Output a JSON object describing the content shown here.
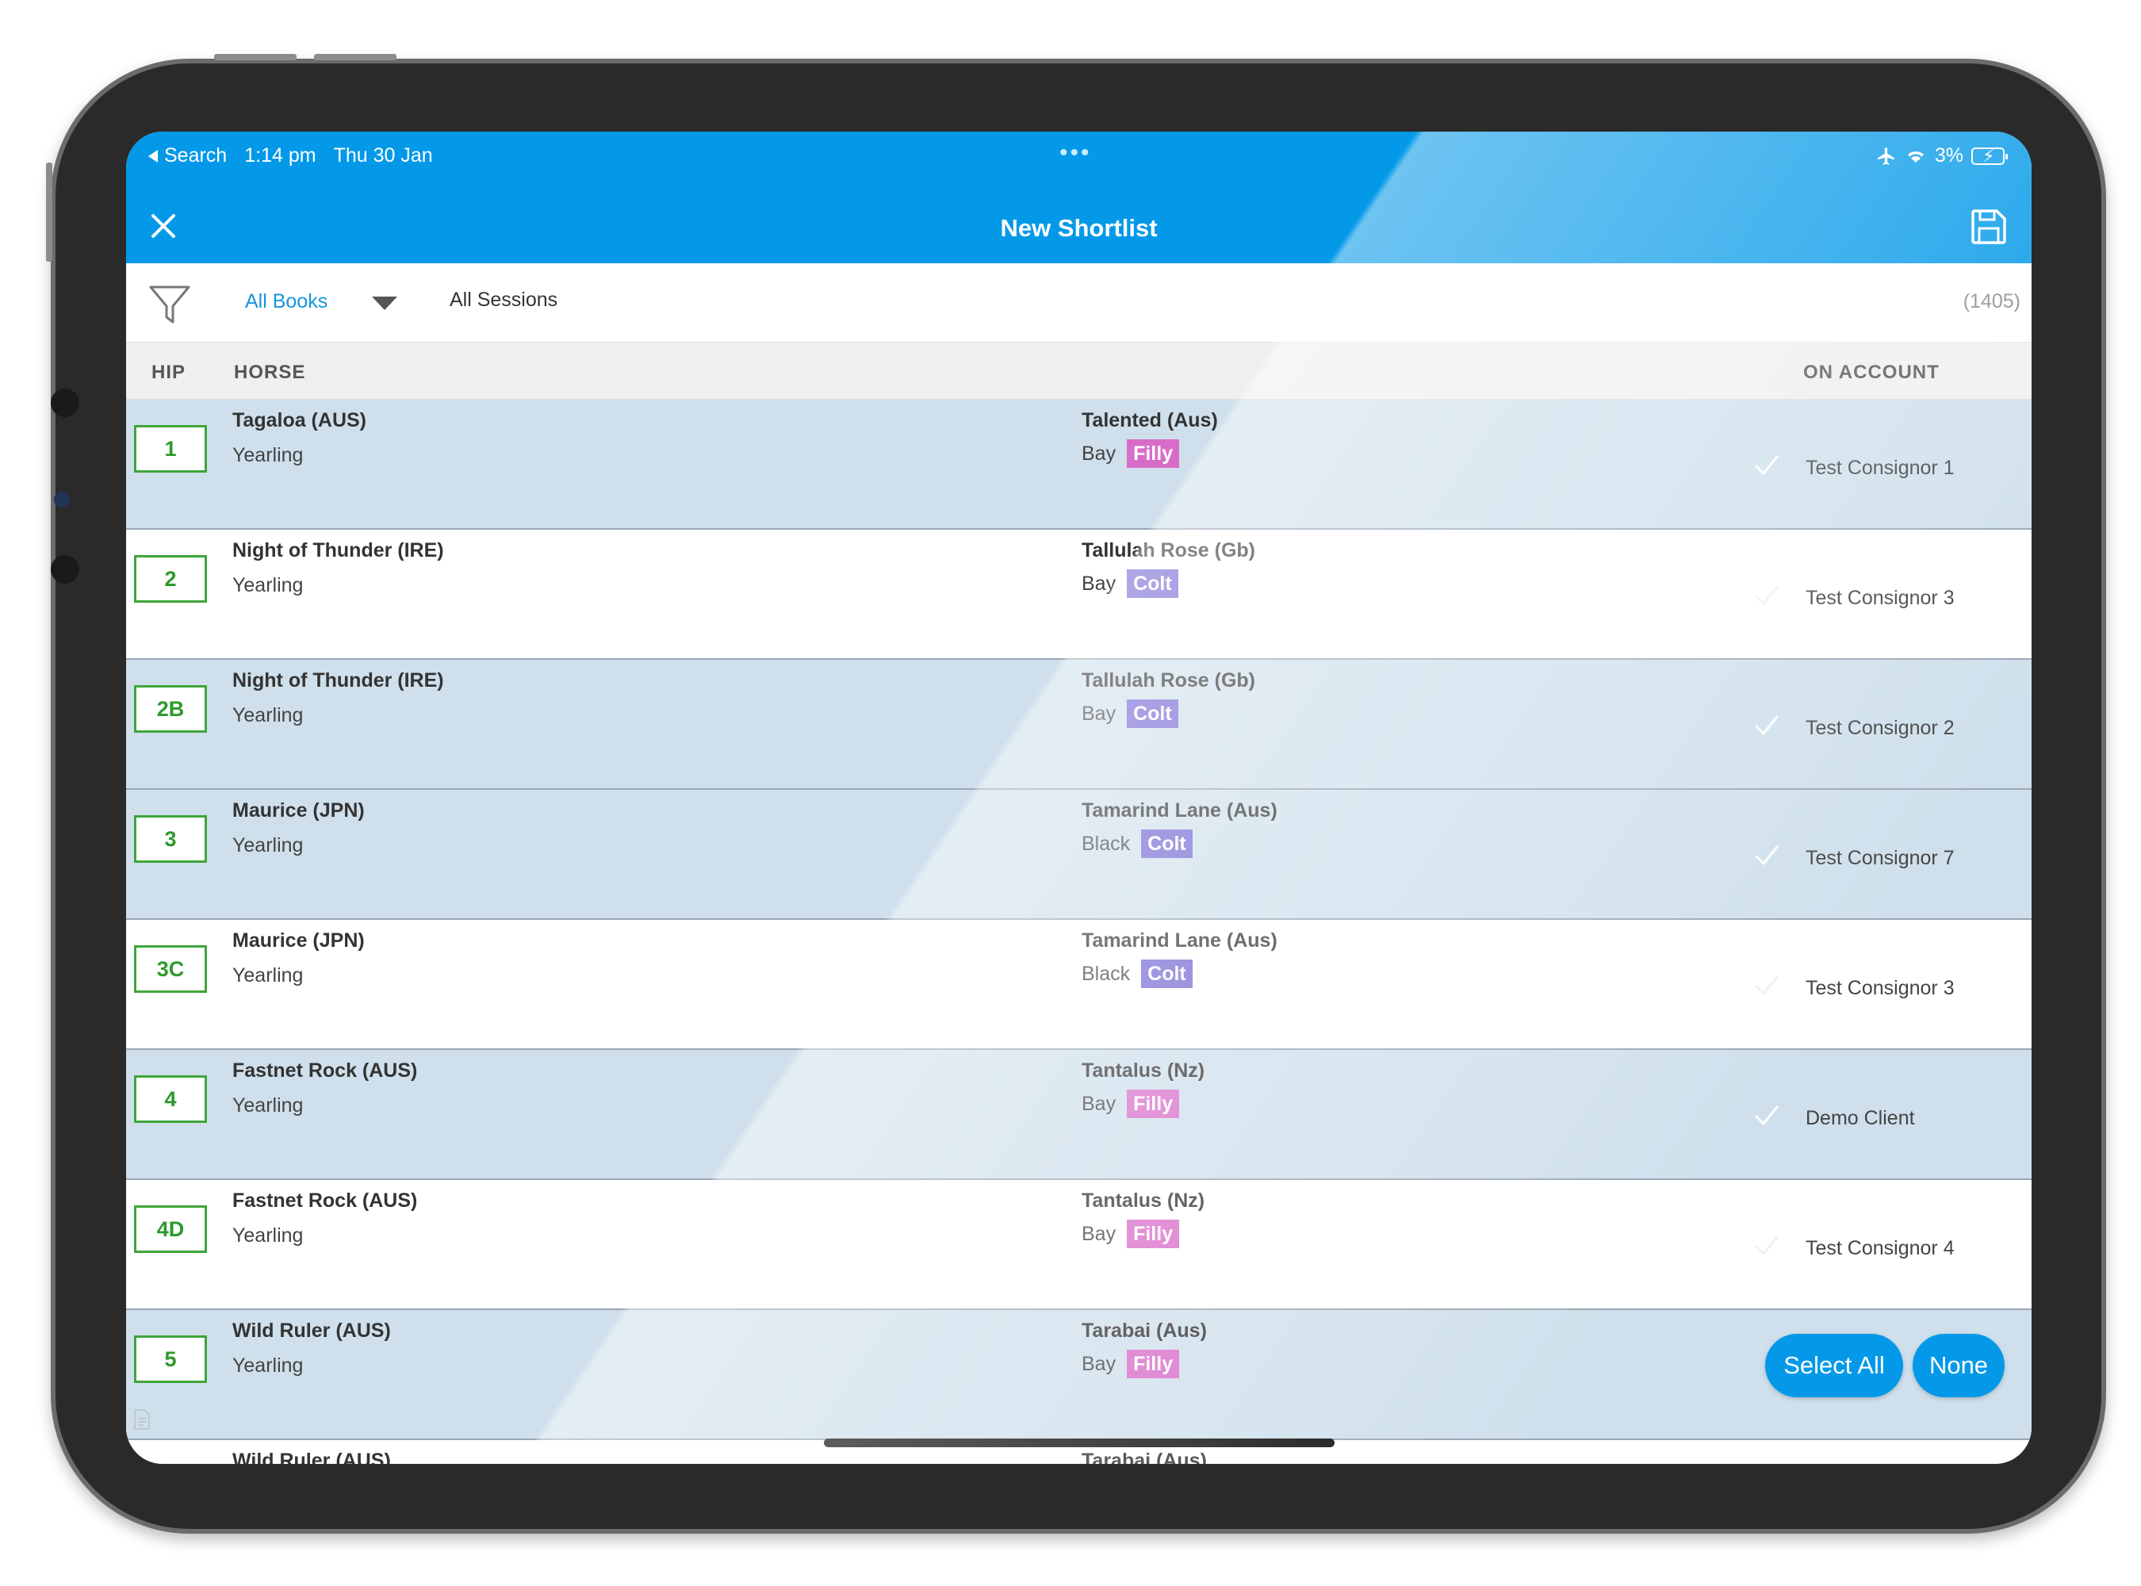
{
  "status_bar": {
    "back_label": "Search",
    "time": "1:14 pm",
    "date": "Thu 30 Jan",
    "dots": "•••",
    "battery": "3%"
  },
  "header": {
    "title": "New Shortlist"
  },
  "filter": {
    "books": "All Books",
    "sessions": "All Sessions",
    "count": "(1405)"
  },
  "columns": {
    "hip": "HIP",
    "horse": "HORSE",
    "account": "ON ACCOUNT"
  },
  "rows": [
    {
      "hip": "1",
      "sire": "Tagaloa (AUS)",
      "age": "Yearling",
      "dam": "Talented (Aus)",
      "color": "Bay",
      "sex": "Filly",
      "account": "Test Consignor 1",
      "selected": true
    },
    {
      "hip": "2",
      "sire": "Night of Thunder (IRE)",
      "age": "Yearling",
      "dam": "Tallulah Rose (Gb)",
      "color": "Bay",
      "sex": "Colt",
      "account": "Test Consignor 3",
      "selected": false
    },
    {
      "hip": "2B",
      "sire": "Night of Thunder (IRE)",
      "age": "Yearling",
      "dam": "Tallulah Rose (Gb)",
      "color": "Bay",
      "sex": "Colt",
      "account": "Test Consignor 2",
      "selected": true
    },
    {
      "hip": "3",
      "sire": "Maurice (JPN)",
      "age": "Yearling",
      "dam": "Tamarind Lane (Aus)",
      "color": "Black",
      "sex": "Colt",
      "account": "Test Consignor 7",
      "selected": true
    },
    {
      "hip": "3C",
      "sire": "Maurice (JPN)",
      "age": "Yearling",
      "dam": "Tamarind Lane (Aus)",
      "color": "Black",
      "sex": "Colt",
      "account": "Test Consignor 3",
      "selected": false
    },
    {
      "hip": "4",
      "sire": "Fastnet Rock (AUS)",
      "age": "Yearling",
      "dam": "Tantalus (Nz)",
      "color": "Bay",
      "sex": "Filly",
      "account": "Demo Client",
      "selected": true
    },
    {
      "hip": "4D",
      "sire": "Fastnet Rock (AUS)",
      "age": "Yearling",
      "dam": "Tantalus (Nz)",
      "color": "Bay",
      "sex": "Filly",
      "account": "Test Consignor 4",
      "selected": false
    },
    {
      "hip": "5",
      "sire": "Wild Ruler (AUS)",
      "age": "Yearling",
      "dam": "Tarabai (Aus)",
      "color": "Bay",
      "sex": "Filly",
      "account": "",
      "selected": true
    },
    {
      "hip": "",
      "sire": "Wild Ruler (AUS)",
      "age": "",
      "dam": "Tarabai (Aus)",
      "color": "",
      "sex": "",
      "account": "",
      "selected": false
    }
  ],
  "actions": {
    "select_all": "Select All",
    "none": "None"
  },
  "colors": {
    "accent": "#0399e8",
    "selected_row": "#cfe0ec",
    "hip_green": "#3fa53a",
    "filly": "#d86dc9",
    "colt": "#7468d3"
  }
}
